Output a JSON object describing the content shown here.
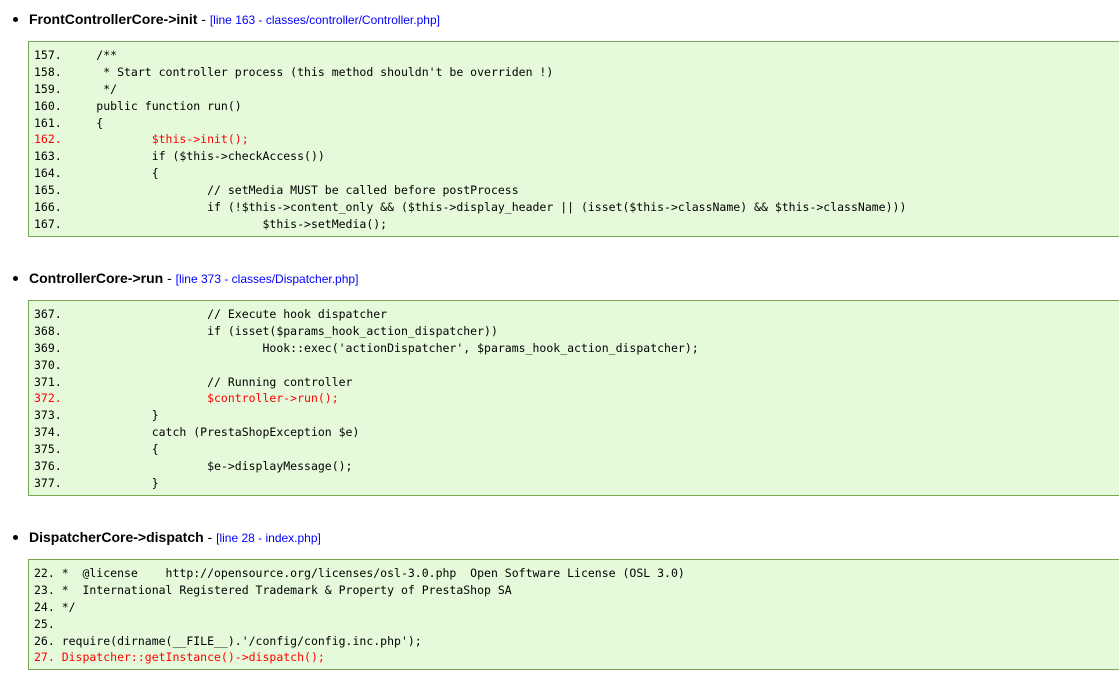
{
  "frames": [
    {
      "function": "FrontControllerCore->init",
      "separator": " - ",
      "location": "[line 163 - classes/controller/Controller.php]",
      "lines": [
        {
          "text": "157.     /**",
          "highlight": false
        },
        {
          "text": "158.      * Start controller process (this method shouldn't be overriden !)",
          "highlight": false
        },
        {
          "text": "159.      */",
          "highlight": false
        },
        {
          "text": "160.     public function run()",
          "highlight": false
        },
        {
          "text": "161.     {",
          "highlight": false
        },
        {
          "text": "162.             $this->init();",
          "highlight": true
        },
        {
          "text": "163.             if ($this->checkAccess())",
          "highlight": false
        },
        {
          "text": "164.             {",
          "highlight": false
        },
        {
          "text": "165.                     // setMedia MUST be called before postProcess",
          "highlight": false
        },
        {
          "text": "166.                     if (!$this->content_only && ($this->display_header || (isset($this->className) && $this->className)))",
          "highlight": false
        },
        {
          "text": "167.                             $this->setMedia();",
          "highlight": false
        }
      ]
    },
    {
      "function": "ControllerCore->run",
      "separator": " - ",
      "location": "[line 373 - classes/Dispatcher.php]",
      "lines": [
        {
          "text": "367.                     // Execute hook dispatcher",
          "highlight": false
        },
        {
          "text": "368.                     if (isset($params_hook_action_dispatcher))",
          "highlight": false
        },
        {
          "text": "369.                             Hook::exec('actionDispatcher', $params_hook_action_dispatcher);",
          "highlight": false
        },
        {
          "text": "370.",
          "highlight": false
        },
        {
          "text": "371.                     // Running controller",
          "highlight": false
        },
        {
          "text": "372.                     $controller->run();",
          "highlight": true
        },
        {
          "text": "373.             }",
          "highlight": false
        },
        {
          "text": "374.             catch (PrestaShopException $e)",
          "highlight": false
        },
        {
          "text": "375.             {",
          "highlight": false
        },
        {
          "text": "376.                     $e->displayMessage();",
          "highlight": false
        },
        {
          "text": "377.             }",
          "highlight": false
        }
      ]
    },
    {
      "function": "DispatcherCore->dispatch",
      "separator": " - ",
      "location": "[line 28 - index.php]",
      "lines": [
        {
          "text": "22. *  @license    http://opensource.org/licenses/osl-3.0.php  Open Software License (OSL 3.0)",
          "highlight": false
        },
        {
          "text": "23. *  International Registered Trademark & Property of PrestaShop SA",
          "highlight": false
        },
        {
          "text": "24. */",
          "highlight": false
        },
        {
          "text": "25.",
          "highlight": false
        },
        {
          "text": "26. require(dirname(__FILE__).'/config/config.inc.php');",
          "highlight": false
        },
        {
          "text": "27. Dispatcher::getInstance()->dispatch();",
          "highlight": true
        }
      ]
    }
  ]
}
